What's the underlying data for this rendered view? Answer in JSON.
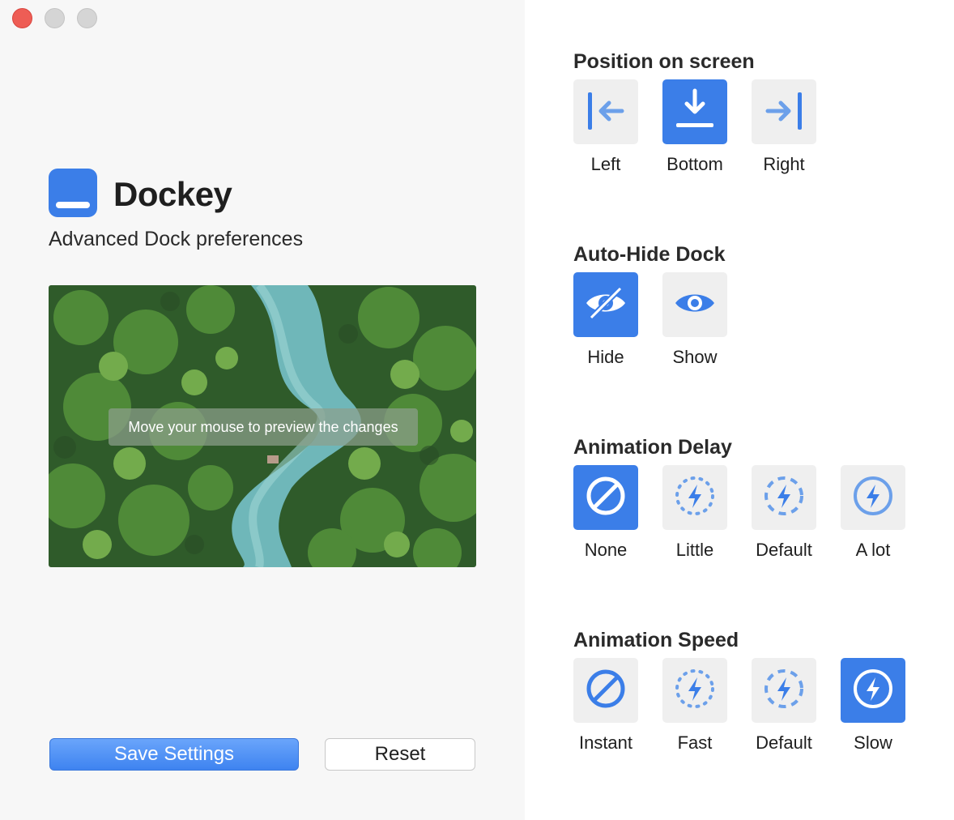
{
  "app": {
    "name": "Dockey",
    "subtitle": "Advanced Dock preferences",
    "preview_hint": "Move your mouse to preview the changes"
  },
  "colors": {
    "accent": "#3b7ee8",
    "tile_bg": "#efefef",
    "icon_light": "#6ca0ea"
  },
  "actions": {
    "save_label": "Save Settings",
    "reset_label": "Reset"
  },
  "sections": [
    {
      "title": "Position on screen",
      "selected": "Bottom",
      "options": [
        {
          "label": "Left",
          "icon": "dock-left-icon"
        },
        {
          "label": "Bottom",
          "icon": "dock-bottom-icon"
        },
        {
          "label": "Right",
          "icon": "dock-right-icon"
        }
      ]
    },
    {
      "title": "Auto-Hide Dock",
      "selected": "Hide",
      "options": [
        {
          "label": "Hide",
          "icon": "eye-slash-icon"
        },
        {
          "label": "Show",
          "icon": "eye-icon"
        }
      ]
    },
    {
      "title": "Animation Delay",
      "selected": "None",
      "options": [
        {
          "label": "None",
          "icon": "none-icon"
        },
        {
          "label": "Little",
          "icon": "bolt-dotted-icon"
        },
        {
          "label": "Default",
          "icon": "bolt-dashed-icon"
        },
        {
          "label": "A lot",
          "icon": "bolt-circle-icon"
        }
      ]
    },
    {
      "title": "Animation Speed",
      "selected": "Slow",
      "options": [
        {
          "label": "Instant",
          "icon": "none-icon"
        },
        {
          "label": "Fast",
          "icon": "bolt-dotted-icon"
        },
        {
          "label": "Default",
          "icon": "bolt-dashed-icon"
        },
        {
          "label": "Slow",
          "icon": "bolt-circle-icon"
        }
      ]
    }
  ]
}
